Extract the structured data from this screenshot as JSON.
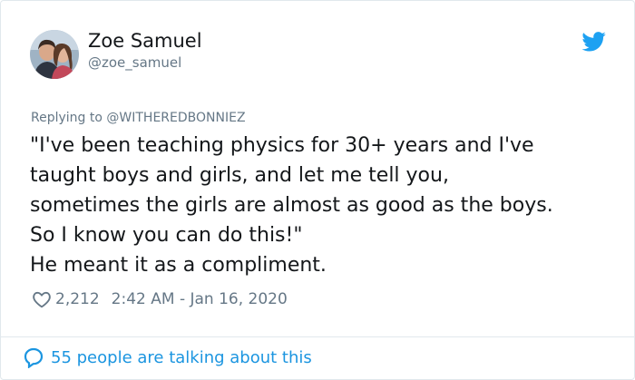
{
  "author": {
    "name": "Zoe Samuel",
    "handle": "@zoe_samuel",
    "avatar_icon": "profile-photo"
  },
  "reply": {
    "prefix": "Replying to ",
    "mention": "@WITHEREDBONNIEZ"
  },
  "tweet": {
    "lines": [
      "\"I've been teaching physics for 30+ years and I've",
      "taught boys and girls, and let me tell you,",
      "sometimes the girls are almost as good as the boys.",
      "So I know you can do this!\"",
      "He meant it as a compliment."
    ]
  },
  "meta": {
    "likes": "2,212",
    "timestamp": "2:42 AM - Jan 16, 2020",
    "heart_icon": "heart-icon"
  },
  "footer": {
    "talking": "55 people are talking about this",
    "icon": "comment-bubble-icon"
  },
  "colors": {
    "twitter_blue": "#1da1f2",
    "link_blue": "#1b95e0",
    "text": "#14171a",
    "muted": "#657786",
    "border": "#e1e8ed"
  }
}
